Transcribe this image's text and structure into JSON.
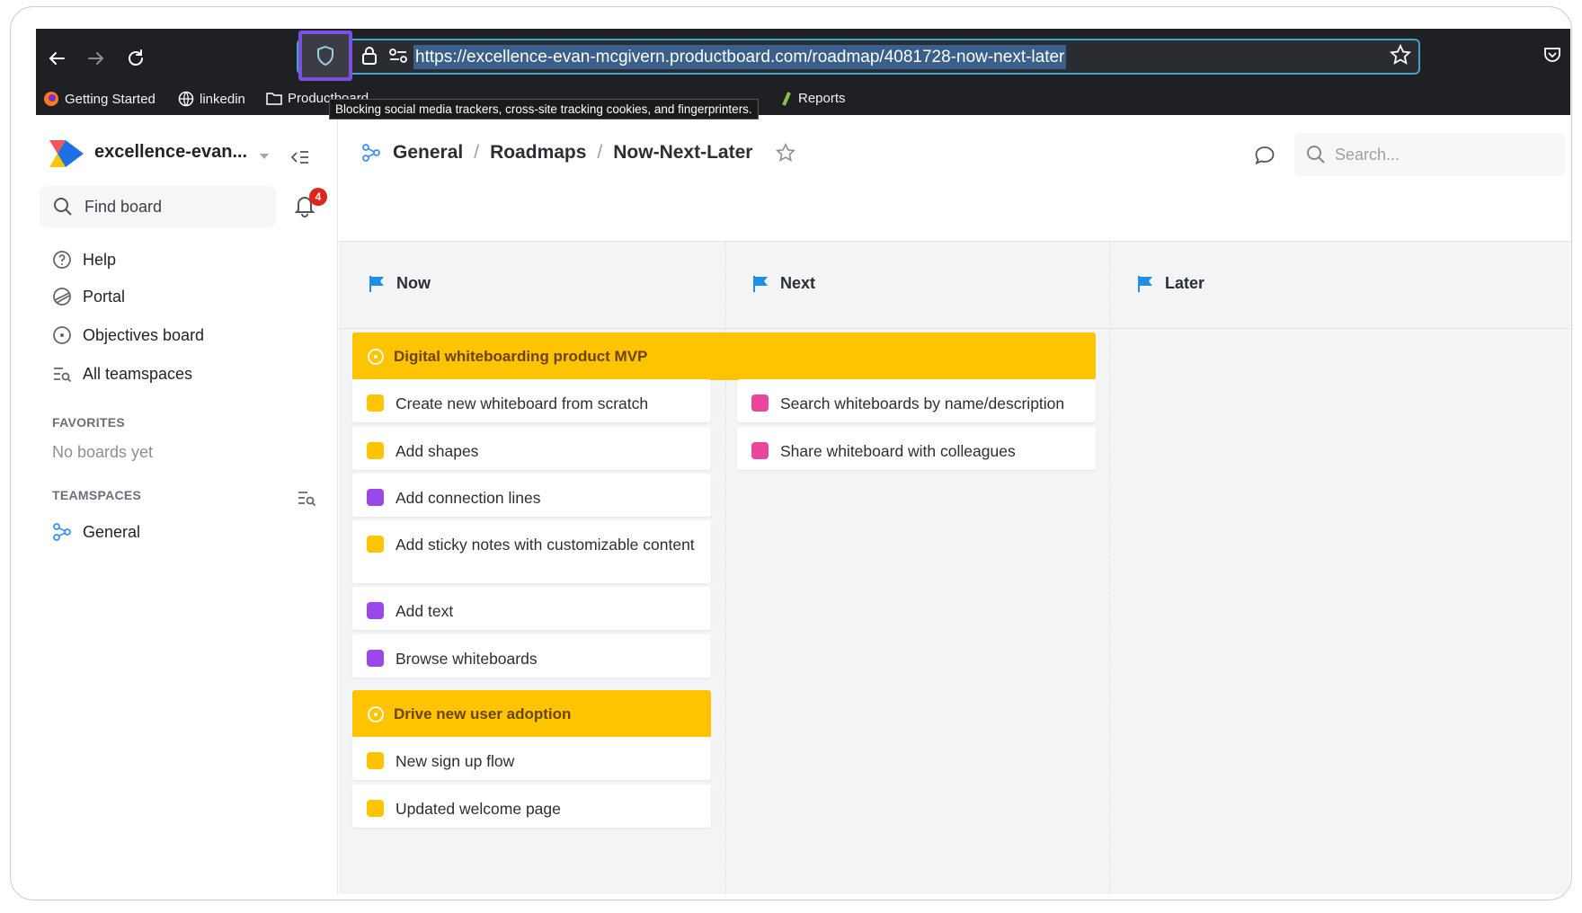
{
  "browser": {
    "url": "https://excellence-evan-mcgivern.productboard.com/roadmap/4081728-now-next-later",
    "tooltip": "Blocking social media trackers, cross-site tracking cookies, and fingerprinters.",
    "bookmarks": [
      "Getting Started",
      "linkedin",
      "Productboard",
      "Reports"
    ]
  },
  "sidebar": {
    "workspace": "excellence-evan...",
    "find_board": "Find board",
    "notifications": "4",
    "nav": [
      "Help",
      "Portal",
      "Objectives board",
      "All teamspaces"
    ],
    "favorites_label": "FAVORITES",
    "favorites_empty": "No boards yet",
    "teamspaces_label": "TEAMSPACES",
    "teamspace": "General"
  },
  "header": {
    "breadcrumb": [
      "General",
      "Roadmaps",
      "Now-Next-Later"
    ],
    "search_placeholder": "Search..."
  },
  "board": {
    "columns": [
      "Now",
      "Next",
      "Later"
    ],
    "objectives": [
      "Digital whiteboarding product MVP",
      "Drive new user adoption"
    ],
    "now_cards": [
      "Create new whiteboard from scratch",
      "Add shapes",
      "Add connection lines",
      "Add sticky notes with customizable content",
      "Add text",
      "Browse whiteboards",
      "New sign up flow",
      "Updated welcome page"
    ],
    "next_cards": [
      "Search whiteboards by name/description",
      "Share whiteboard with colleagues"
    ]
  },
  "colors": {
    "yellow": "#ffc400",
    "purple": "#9a48ea",
    "pink": "#e8479b",
    "flag_blue": "#1f8fe5",
    "url_border": "#3aa6c4",
    "shield_highlight": "#7b4fe0"
  }
}
